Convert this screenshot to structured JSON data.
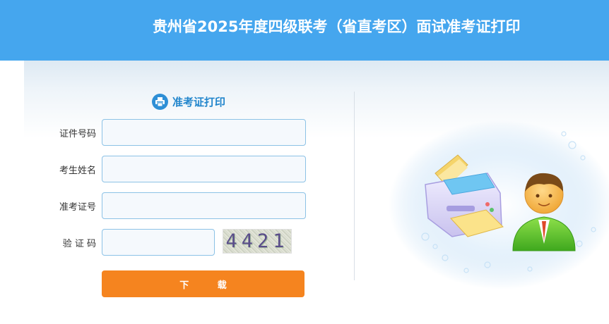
{
  "header": {
    "title": "贵州省2025年度四级联考（省直考区）面试准考证打印"
  },
  "form": {
    "title": "准考证打印",
    "title_icon": "printer-icon",
    "fields": [
      {
        "label": "证件号码",
        "value": "",
        "placeholder": ""
      },
      {
        "label": "考生姓名",
        "value": "",
        "placeholder": ""
      },
      {
        "label": "准考证号",
        "value": "",
        "placeholder": ""
      },
      {
        "label": "验 证 码",
        "value": "",
        "placeholder": ""
      }
    ],
    "captcha_text": "4421",
    "submit_label": "下 载"
  },
  "illustration": {
    "icon": "printer-and-user-illustration"
  },
  "colors": {
    "header": "#45a6ee",
    "accent": "#2386cc",
    "button": "#f5841f",
    "field_border": "#8cc2e6"
  }
}
